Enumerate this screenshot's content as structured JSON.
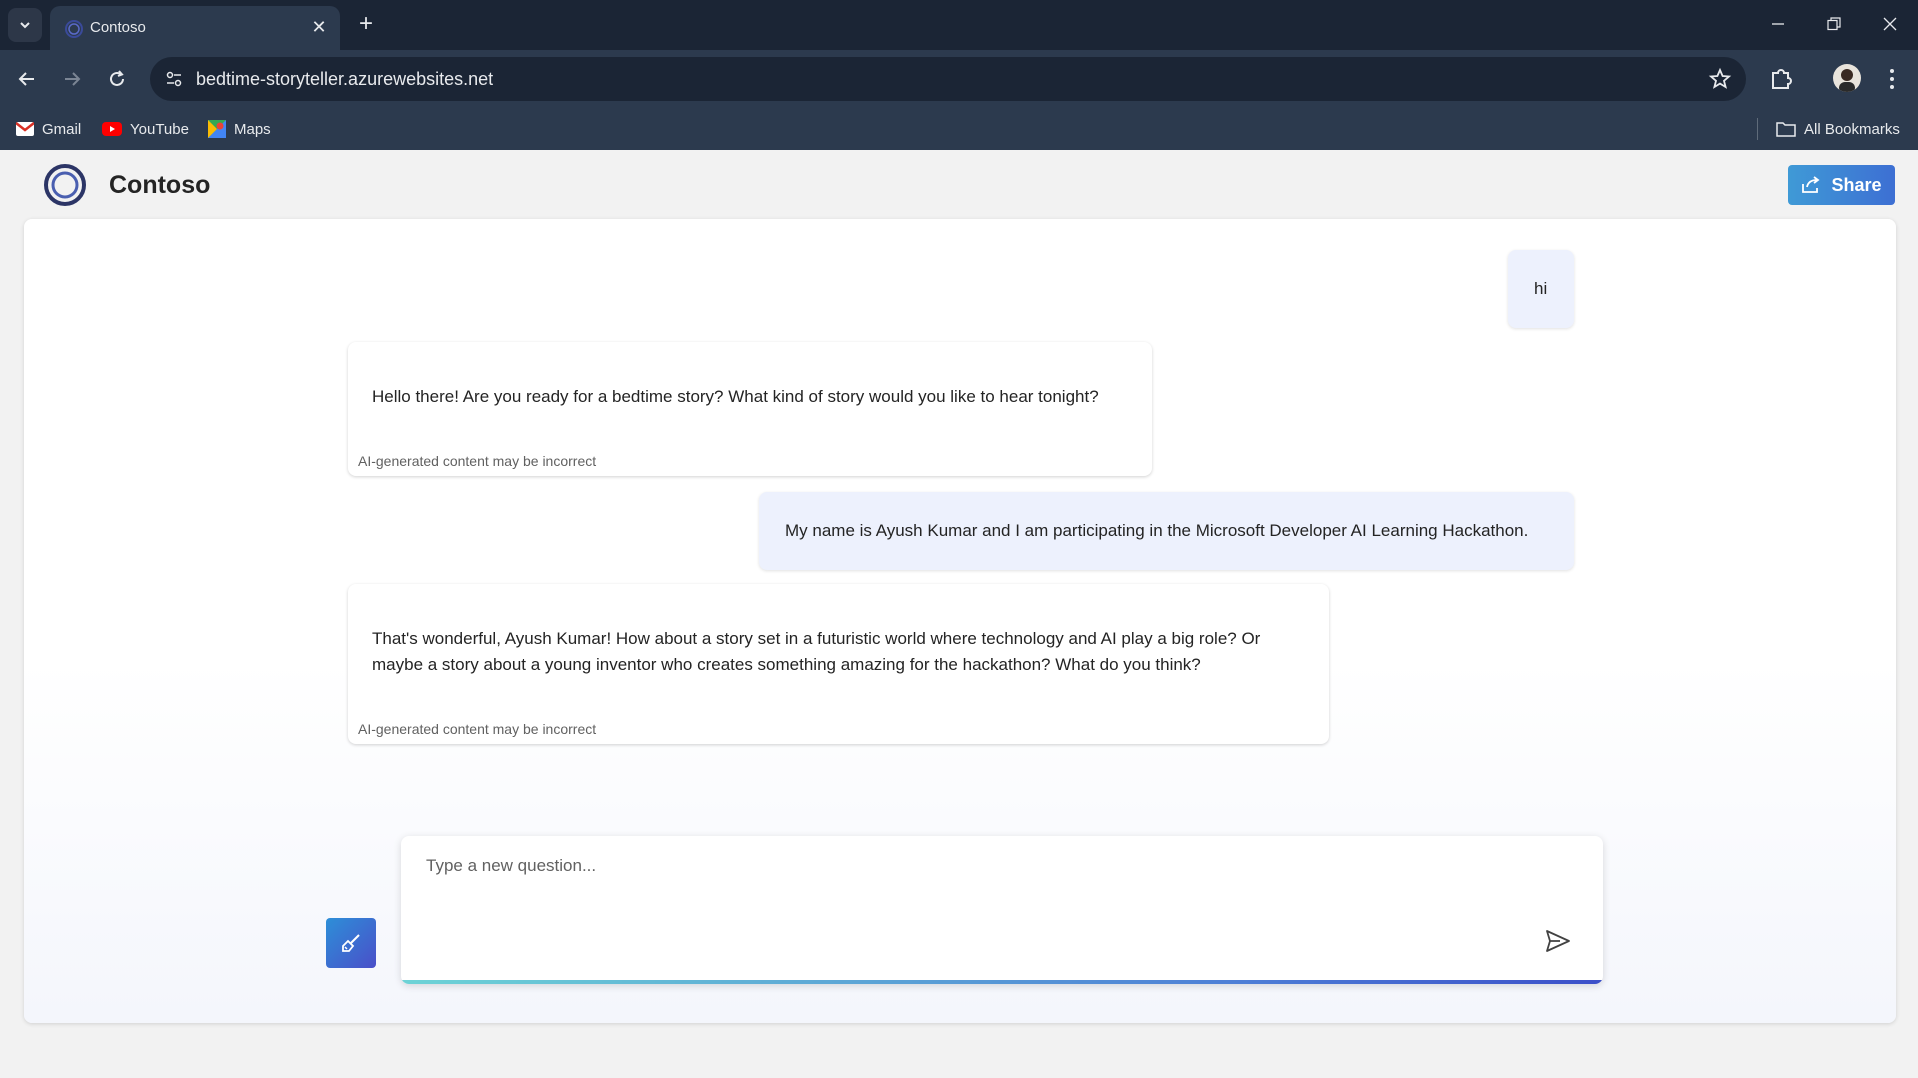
{
  "browser": {
    "tab_title": "Contoso",
    "url": "bedtime-storyteller.azurewebsites.net",
    "bookmarks": [
      {
        "label": "Gmail",
        "icon": "gmail-icon"
      },
      {
        "label": "YouTube",
        "icon": "youtube-icon"
      },
      {
        "label": "Maps",
        "icon": "maps-icon"
      }
    ],
    "all_bookmarks_label": "All Bookmarks"
  },
  "app": {
    "title": "Contoso",
    "share_label": "Share",
    "accent_color": "#3d6fd3"
  },
  "chat": {
    "messages": [
      {
        "role": "user",
        "text": "hi"
      },
      {
        "role": "assistant",
        "text": "Hello there! Are you ready for a bedtime story? What kind of story would you like to hear tonight?",
        "disclaimer": "AI-generated content may be incorrect"
      },
      {
        "role": "user",
        "text": "My name is Ayush Kumar and I am participating in the Microsoft Developer AI Learning Hackathon."
      },
      {
        "role": "assistant",
        "text": "That's wonderful, Ayush Kumar! How about a story set in a futuristic world where technology and AI play a big role? Or maybe a story about a young inventor who creates something amazing for the hackathon? What do you think?",
        "disclaimer": "AI-generated content may be incorrect"
      }
    ],
    "input_placeholder": "Type a new question..."
  }
}
